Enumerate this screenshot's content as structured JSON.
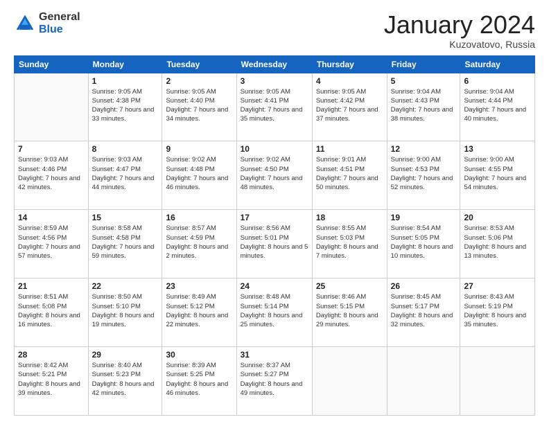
{
  "logo": {
    "general": "General",
    "blue": "Blue"
  },
  "title": "January 2024",
  "location": "Kuzovatovo, Russia",
  "header_days": [
    "Sunday",
    "Monday",
    "Tuesday",
    "Wednesday",
    "Thursday",
    "Friday",
    "Saturday"
  ],
  "weeks": [
    [
      {
        "num": "",
        "sunrise": "",
        "sunset": "",
        "daylight": ""
      },
      {
        "num": "1",
        "sunrise": "Sunrise: 9:05 AM",
        "sunset": "Sunset: 4:38 PM",
        "daylight": "Daylight: 7 hours and 33 minutes."
      },
      {
        "num": "2",
        "sunrise": "Sunrise: 9:05 AM",
        "sunset": "Sunset: 4:40 PM",
        "daylight": "Daylight: 7 hours and 34 minutes."
      },
      {
        "num": "3",
        "sunrise": "Sunrise: 9:05 AM",
        "sunset": "Sunset: 4:41 PM",
        "daylight": "Daylight: 7 hours and 35 minutes."
      },
      {
        "num": "4",
        "sunrise": "Sunrise: 9:05 AM",
        "sunset": "Sunset: 4:42 PM",
        "daylight": "Daylight: 7 hours and 37 minutes."
      },
      {
        "num": "5",
        "sunrise": "Sunrise: 9:04 AM",
        "sunset": "Sunset: 4:43 PM",
        "daylight": "Daylight: 7 hours and 38 minutes."
      },
      {
        "num": "6",
        "sunrise": "Sunrise: 9:04 AM",
        "sunset": "Sunset: 4:44 PM",
        "daylight": "Daylight: 7 hours and 40 minutes."
      }
    ],
    [
      {
        "num": "7",
        "sunrise": "Sunrise: 9:03 AM",
        "sunset": "Sunset: 4:46 PM",
        "daylight": "Daylight: 7 hours and 42 minutes."
      },
      {
        "num": "8",
        "sunrise": "Sunrise: 9:03 AM",
        "sunset": "Sunset: 4:47 PM",
        "daylight": "Daylight: 7 hours and 44 minutes."
      },
      {
        "num": "9",
        "sunrise": "Sunrise: 9:02 AM",
        "sunset": "Sunset: 4:48 PM",
        "daylight": "Daylight: 7 hours and 46 minutes."
      },
      {
        "num": "10",
        "sunrise": "Sunrise: 9:02 AM",
        "sunset": "Sunset: 4:50 PM",
        "daylight": "Daylight: 7 hours and 48 minutes."
      },
      {
        "num": "11",
        "sunrise": "Sunrise: 9:01 AM",
        "sunset": "Sunset: 4:51 PM",
        "daylight": "Daylight: 7 hours and 50 minutes."
      },
      {
        "num": "12",
        "sunrise": "Sunrise: 9:00 AM",
        "sunset": "Sunset: 4:53 PM",
        "daylight": "Daylight: 7 hours and 52 minutes."
      },
      {
        "num": "13",
        "sunrise": "Sunrise: 9:00 AM",
        "sunset": "Sunset: 4:55 PM",
        "daylight": "Daylight: 7 hours and 54 minutes."
      }
    ],
    [
      {
        "num": "14",
        "sunrise": "Sunrise: 8:59 AM",
        "sunset": "Sunset: 4:56 PM",
        "daylight": "Daylight: 7 hours and 57 minutes."
      },
      {
        "num": "15",
        "sunrise": "Sunrise: 8:58 AM",
        "sunset": "Sunset: 4:58 PM",
        "daylight": "Daylight: 7 hours and 59 minutes."
      },
      {
        "num": "16",
        "sunrise": "Sunrise: 8:57 AM",
        "sunset": "Sunset: 4:59 PM",
        "daylight": "Daylight: 8 hours and 2 minutes."
      },
      {
        "num": "17",
        "sunrise": "Sunrise: 8:56 AM",
        "sunset": "Sunset: 5:01 PM",
        "daylight": "Daylight: 8 hours and 5 minutes."
      },
      {
        "num": "18",
        "sunrise": "Sunrise: 8:55 AM",
        "sunset": "Sunset: 5:03 PM",
        "daylight": "Daylight: 8 hours and 7 minutes."
      },
      {
        "num": "19",
        "sunrise": "Sunrise: 8:54 AM",
        "sunset": "Sunset: 5:05 PM",
        "daylight": "Daylight: 8 hours and 10 minutes."
      },
      {
        "num": "20",
        "sunrise": "Sunrise: 8:53 AM",
        "sunset": "Sunset: 5:06 PM",
        "daylight": "Daylight: 8 hours and 13 minutes."
      }
    ],
    [
      {
        "num": "21",
        "sunrise": "Sunrise: 8:51 AM",
        "sunset": "Sunset: 5:08 PM",
        "daylight": "Daylight: 8 hours and 16 minutes."
      },
      {
        "num": "22",
        "sunrise": "Sunrise: 8:50 AM",
        "sunset": "Sunset: 5:10 PM",
        "daylight": "Daylight: 8 hours and 19 minutes."
      },
      {
        "num": "23",
        "sunrise": "Sunrise: 8:49 AM",
        "sunset": "Sunset: 5:12 PM",
        "daylight": "Daylight: 8 hours and 22 minutes."
      },
      {
        "num": "24",
        "sunrise": "Sunrise: 8:48 AM",
        "sunset": "Sunset: 5:14 PM",
        "daylight": "Daylight: 8 hours and 25 minutes."
      },
      {
        "num": "25",
        "sunrise": "Sunrise: 8:46 AM",
        "sunset": "Sunset: 5:15 PM",
        "daylight": "Daylight: 8 hours and 29 minutes."
      },
      {
        "num": "26",
        "sunrise": "Sunrise: 8:45 AM",
        "sunset": "Sunset: 5:17 PM",
        "daylight": "Daylight: 8 hours and 32 minutes."
      },
      {
        "num": "27",
        "sunrise": "Sunrise: 8:43 AM",
        "sunset": "Sunset: 5:19 PM",
        "daylight": "Daylight: 8 hours and 35 minutes."
      }
    ],
    [
      {
        "num": "28",
        "sunrise": "Sunrise: 8:42 AM",
        "sunset": "Sunset: 5:21 PM",
        "daylight": "Daylight: 8 hours and 39 minutes."
      },
      {
        "num": "29",
        "sunrise": "Sunrise: 8:40 AM",
        "sunset": "Sunset: 5:23 PM",
        "daylight": "Daylight: 8 hours and 42 minutes."
      },
      {
        "num": "30",
        "sunrise": "Sunrise: 8:39 AM",
        "sunset": "Sunset: 5:25 PM",
        "daylight": "Daylight: 8 hours and 46 minutes."
      },
      {
        "num": "31",
        "sunrise": "Sunrise: 8:37 AM",
        "sunset": "Sunset: 5:27 PM",
        "daylight": "Daylight: 8 hours and 49 minutes."
      },
      {
        "num": "",
        "sunrise": "",
        "sunset": "",
        "daylight": ""
      },
      {
        "num": "",
        "sunrise": "",
        "sunset": "",
        "daylight": ""
      },
      {
        "num": "",
        "sunrise": "",
        "sunset": "",
        "daylight": ""
      }
    ]
  ]
}
